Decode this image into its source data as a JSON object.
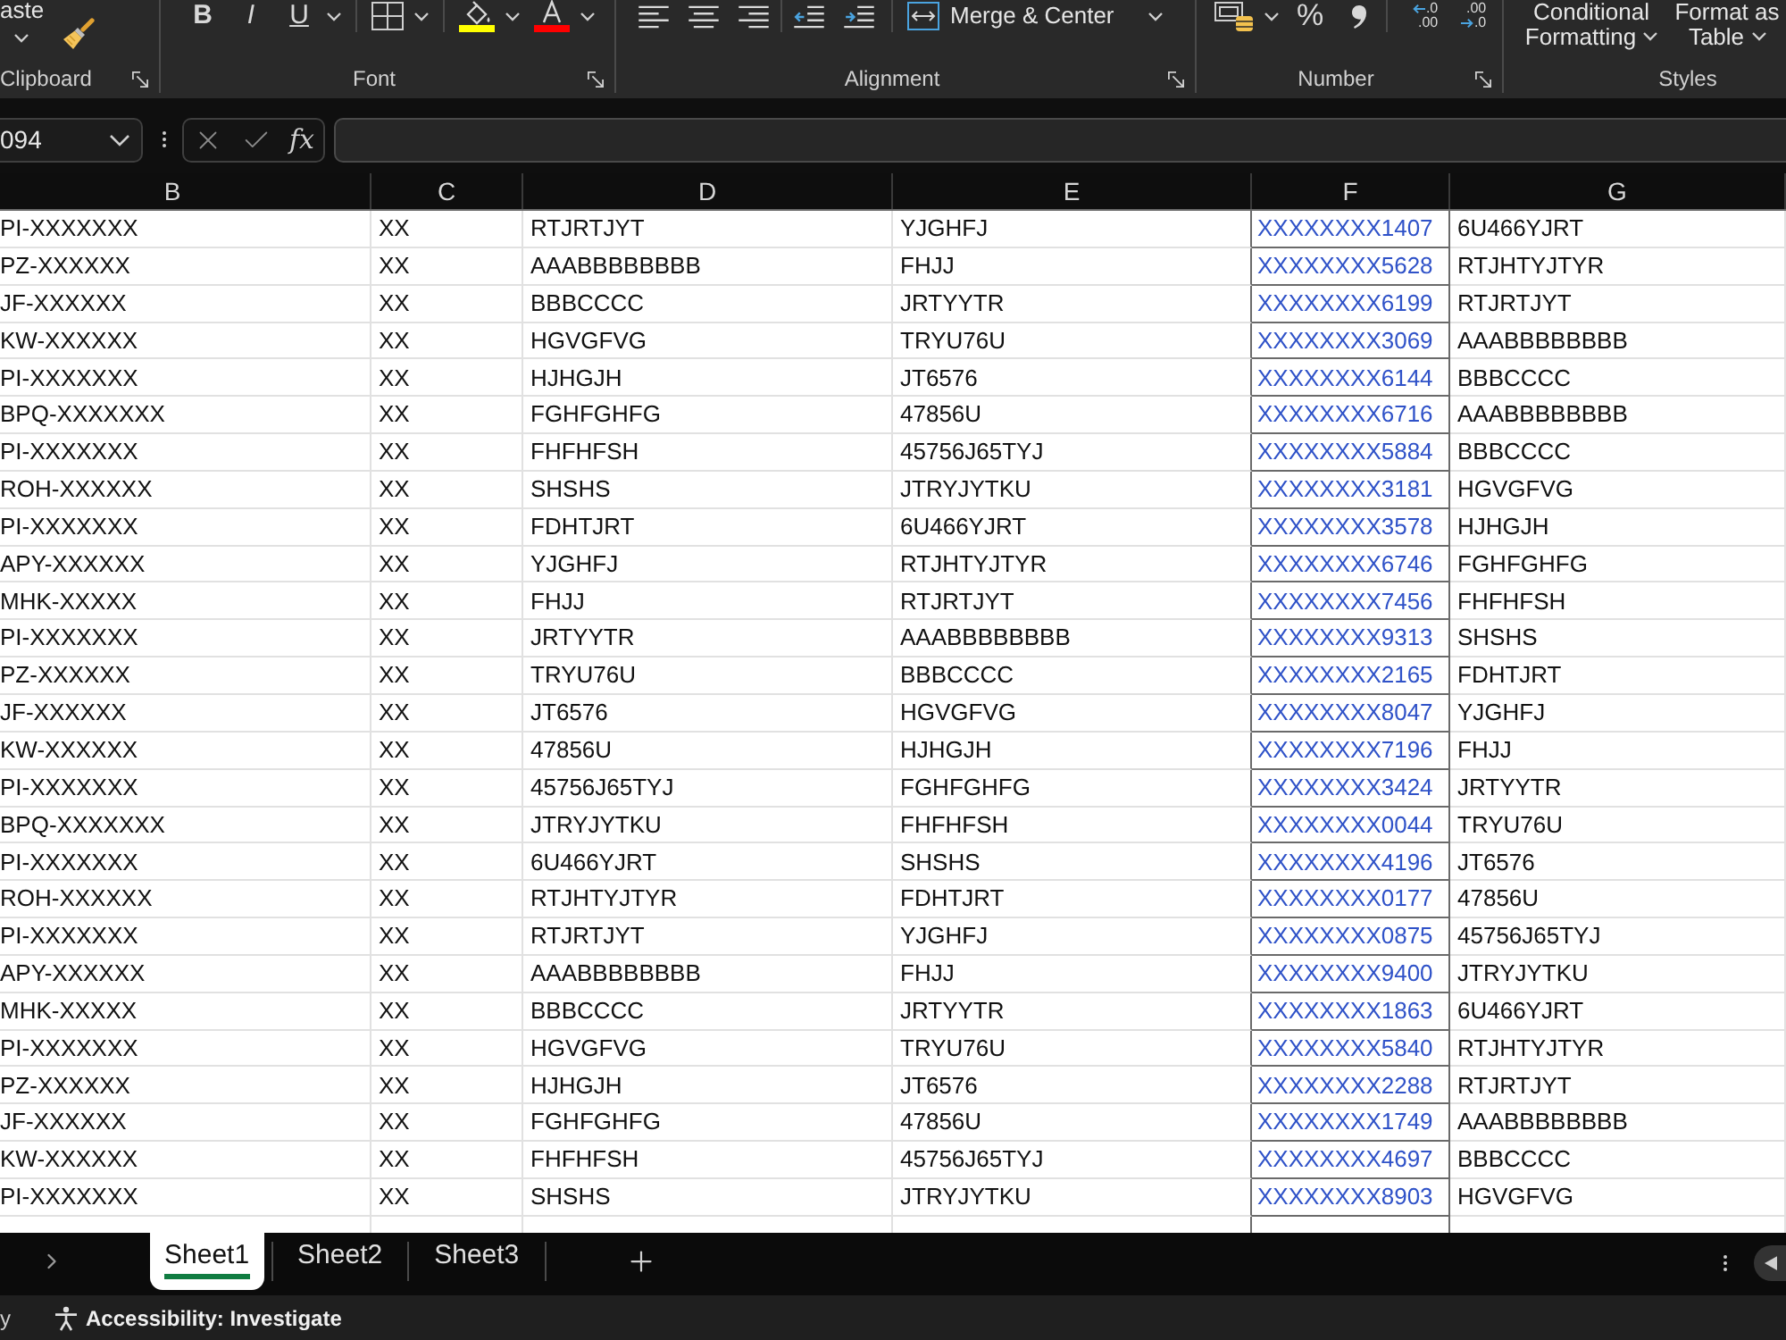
{
  "ribbon": {
    "groups": [
      {
        "kind": "clipboard",
        "label": "Clipboard",
        "launcher": true,
        "paste_label": "aste"
      },
      {
        "kind": "font",
        "label": "Font",
        "launcher": true,
        "style_buttons": [
          "B",
          "I",
          "U"
        ]
      },
      {
        "kind": "alignment",
        "label": "Alignment",
        "launcher": true,
        "merge_label": "Merge & Center"
      },
      {
        "kind": "number",
        "label": "Number",
        "launcher": true,
        "percent_label": "%",
        "decimal_buttons": [
          {
            "kind": "increase",
            "top": ".0",
            "bottom": ".00"
          },
          {
            "kind": "decrease",
            "top": ".00",
            "bottom": ".0"
          }
        ]
      },
      {
        "kind": "styles",
        "label": "Styles",
        "launcher": false,
        "buttons": [
          {
            "lines": [
              "Conditional",
              "Formatting"
            ]
          },
          {
            "lines": [
              "Format as",
              "Table"
            ]
          }
        ]
      }
    ]
  },
  "formula_bar": {
    "name_box": "094",
    "function_label": "fx"
  },
  "sheet": {
    "columns": [
      {
        "label": "B",
        "kind": "cut"
      },
      {
        "label": "C",
        "kind": "plain"
      },
      {
        "label": "D",
        "kind": "plain"
      },
      {
        "label": "E",
        "kind": "plain"
      },
      {
        "label": "F",
        "kind": "bordered"
      },
      {
        "label": "G",
        "kind": "plain"
      }
    ],
    "rows": [
      [
        "PI-XXXXXXX",
        "XX",
        "RTJRTJYT",
        "YJGHFJ",
        "XXXXXXXX1407",
        "6U466YJRT"
      ],
      [
        "PZ-XXXXXX",
        "XX",
        "AAABBBBBBBB",
        "FHJJ",
        "XXXXXXXX5628",
        "RTJHTYJTYR"
      ],
      [
        "JF-XXXXXX",
        "XX",
        "BBBCCCC",
        "JRTYYTR",
        "XXXXXXXX6199",
        "RTJRTJYT"
      ],
      [
        "KW-XXXXXX",
        "XX",
        "HGVGFVG",
        "TRYU76U",
        "XXXXXXXX3069",
        "AAABBBBBBBB"
      ],
      [
        "PI-XXXXXXX",
        "XX",
        "HJHGJH",
        "JT6576",
        "XXXXXXXX6144",
        "BBBCCCC"
      ],
      [
        "BPQ-XXXXXXX",
        "XX",
        "FGHFGHFG",
        "47856U",
        "XXXXXXXX6716",
        "AAABBBBBBBB"
      ],
      [
        "PI-XXXXXXX",
        "XX",
        "FHFHFSH",
        "45756J65TYJ",
        "XXXXXXXX5884",
        "BBBCCCC"
      ],
      [
        "ROH-XXXXXX",
        "XX",
        "SHSHS",
        "JTRYJYTKU",
        "XXXXXXXX3181",
        "HGVGFVG"
      ],
      [
        "PI-XXXXXXX",
        "XX",
        "FDHTJRT",
        "6U466YJRT",
        "XXXXXXXX3578",
        "HJHGJH"
      ],
      [
        "APY-XXXXXX",
        "XX",
        "YJGHFJ",
        "RTJHTYJTYR",
        "XXXXXXXX6746",
        "FGHFGHFG"
      ],
      [
        "MHK-XXXXX",
        "XX",
        "FHJJ",
        "RTJRTJYT",
        "XXXXXXXX7456",
        "FHFHFSH"
      ],
      [
        "PI-XXXXXXX",
        "XX",
        "JRTYYTR",
        "AAABBBBBBBB",
        "XXXXXXXX9313",
        "SHSHS"
      ],
      [
        "PZ-XXXXXX",
        "XX",
        "TRYU76U",
        "BBBCCCC",
        "XXXXXXXX2165",
        "FDHTJRT"
      ],
      [
        "JF-XXXXXX",
        "XX",
        "JT6576",
        "HGVGFVG",
        "XXXXXXXX8047",
        "YJGHFJ"
      ],
      [
        "KW-XXXXXX",
        "XX",
        "47856U",
        "HJHGJH",
        "XXXXXXXX7196",
        "FHJJ"
      ],
      [
        "PI-XXXXXXX",
        "XX",
        "45756J65TYJ",
        "FGHFGHFG",
        "XXXXXXXX3424",
        "JRTYYTR"
      ],
      [
        "BPQ-XXXXXXX",
        "XX",
        "JTRYJYTKU",
        "FHFHFSH",
        "XXXXXXXX0044",
        "TRYU76U"
      ],
      [
        "PI-XXXXXXX",
        "XX",
        "6U466YJRT",
        "SHSHS",
        "XXXXXXXX4196",
        "JT6576"
      ],
      [
        "ROH-XXXXXX",
        "XX",
        "RTJHTYJTYR",
        "FDHTJRT",
        "XXXXXXXX0177",
        "47856U"
      ],
      [
        "PI-XXXXXXX",
        "XX",
        "RTJRTJYT",
        "YJGHFJ",
        "XXXXXXXX0875",
        "45756J65TYJ"
      ],
      [
        "APY-XXXXXX",
        "XX",
        "AAABBBBBBBB",
        "FHJJ",
        "XXXXXXXX9400",
        "JTRYJYTKU"
      ],
      [
        "MHK-XXXXX",
        "XX",
        "BBBCCCC",
        "JRTYYTR",
        "XXXXXXXX1863",
        "6U466YJRT"
      ],
      [
        "PI-XXXXXXX",
        "XX",
        "HGVGFVG",
        "TRYU76U",
        "XXXXXXXX5840",
        "RTJHTYJTYR"
      ],
      [
        "PZ-XXXXXX",
        "XX",
        "HJHGJH",
        "JT6576",
        "XXXXXXXX2288",
        "RTJRTJYT"
      ],
      [
        "JF-XXXXXX",
        "XX",
        "FGHFGHFG",
        "47856U",
        "XXXXXXXX1749",
        "AAABBBBBBBB"
      ],
      [
        "KW-XXXXXX",
        "XX",
        "FHFHFSH",
        "45756J65TYJ",
        "XXXXXXXX4697",
        "BBBCCCC"
      ],
      [
        "PI-XXXXXXX",
        "XX",
        "SHSHS",
        "JTRYJYTKU",
        "XXXXXXXX8903",
        "HGVGFVG"
      ]
    ]
  },
  "sheet_tabs": [
    {
      "label": "Sheet1",
      "selected": true
    },
    {
      "label": "Sheet2",
      "selected": false
    },
    {
      "label": "Sheet3",
      "selected": false
    }
  ],
  "status_bar": {
    "mode": "y",
    "accessibility": "Accessibility: Investigate"
  }
}
